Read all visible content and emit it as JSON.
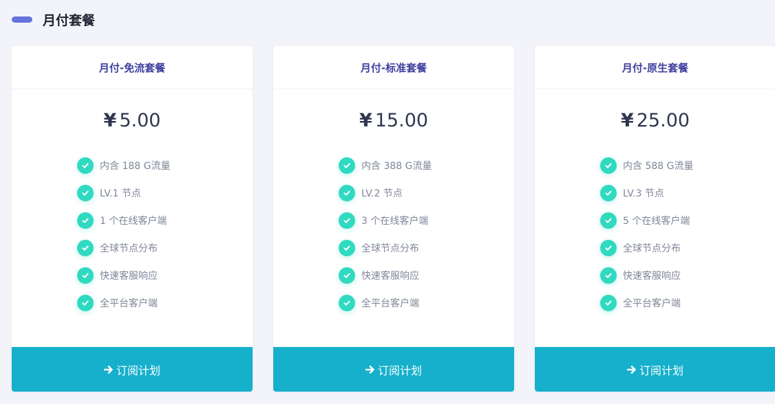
{
  "section": {
    "title": "月付套餐"
  },
  "colors": {
    "accent_bar": "#6673dd",
    "plan_title": "#3c3f9e",
    "check": "#30dac1",
    "button": "#16b0cc"
  },
  "plans": [
    {
      "title": "月付-免流套餐",
      "price": "5.00",
      "currency": "¥",
      "features": [
        "内含 188 G流量",
        "LV.1 节点",
        "1 个在线客户端",
        "全球节点分布",
        "快速客服响应",
        "全平台客户端"
      ],
      "button_label": "订阅计划",
      "button_icon": "arrow-right-icon"
    },
    {
      "title": "月付-标准套餐",
      "price": "15.00",
      "currency": "¥",
      "features": [
        "内含 388 G流量",
        "LV.2 节点",
        "3 个在线客户端",
        "全球节点分布",
        "快速客服响应",
        "全平台客户端"
      ],
      "button_label": "订阅计划",
      "button_icon": "arrow-right-icon"
    },
    {
      "title": "月付-原生套餐",
      "price": "25.00",
      "currency": "¥",
      "features": [
        "内含 588 G流量",
        "LV.3 节点",
        "5 个在线客户端",
        "全球节点分布",
        "快速客服响应",
        "全平台客户端"
      ],
      "button_label": "订阅计划",
      "button_icon": "arrow-right-icon"
    }
  ]
}
